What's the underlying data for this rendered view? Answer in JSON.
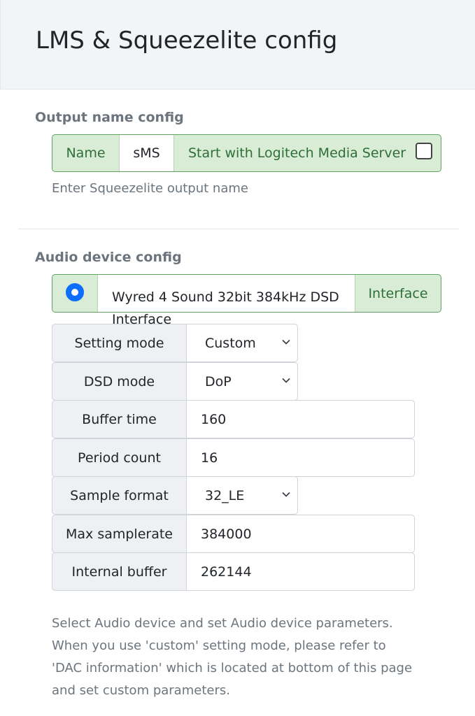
{
  "page": {
    "title": "LMS & Squeezelite config"
  },
  "output_section": {
    "title": "Output name config",
    "name_label": "Name",
    "name_value": "sMS",
    "lms_label": "Start with Logitech Media Server",
    "lms_checked": false,
    "help": "Enter Squeezelite output name"
  },
  "audio_section": {
    "title": "Audio device config",
    "device_selected": true,
    "device_name": "Wyred 4 Sound 32bit 384kHz DSD Interface",
    "interface_label": "Interface",
    "params": [
      {
        "label": "Setting mode",
        "value": "Custom",
        "type": "select"
      },
      {
        "label": "DSD mode",
        "value": "DoP",
        "type": "select"
      },
      {
        "label": "Buffer time",
        "value": "160",
        "type": "input"
      },
      {
        "label": "Period count",
        "value": "16",
        "type": "input"
      },
      {
        "label": "Sample format",
        "value": "32_LE",
        "type": "select"
      },
      {
        "label": "Max samplerate",
        "value": "384000",
        "type": "input"
      },
      {
        "label": "Internal buffer",
        "value": "262144",
        "type": "input"
      }
    ],
    "help_lines": [
      "Select Audio device and set Audio device parameters.",
      "When you use 'custom' setting mode, please refer to",
      "'DAC information' which is located at bottom of this page",
      "and set custom parameters."
    ]
  },
  "icons": {
    "select_arrow": "chevron-down-icon",
    "radio": "radio-selected-icon",
    "checkbox": "checkbox-icon"
  },
  "colors": {
    "accent": "#0d6efd",
    "success_bg": "#d8ecd6",
    "success_border": "#5ea35e",
    "success_text": "#2f6f37"
  }
}
